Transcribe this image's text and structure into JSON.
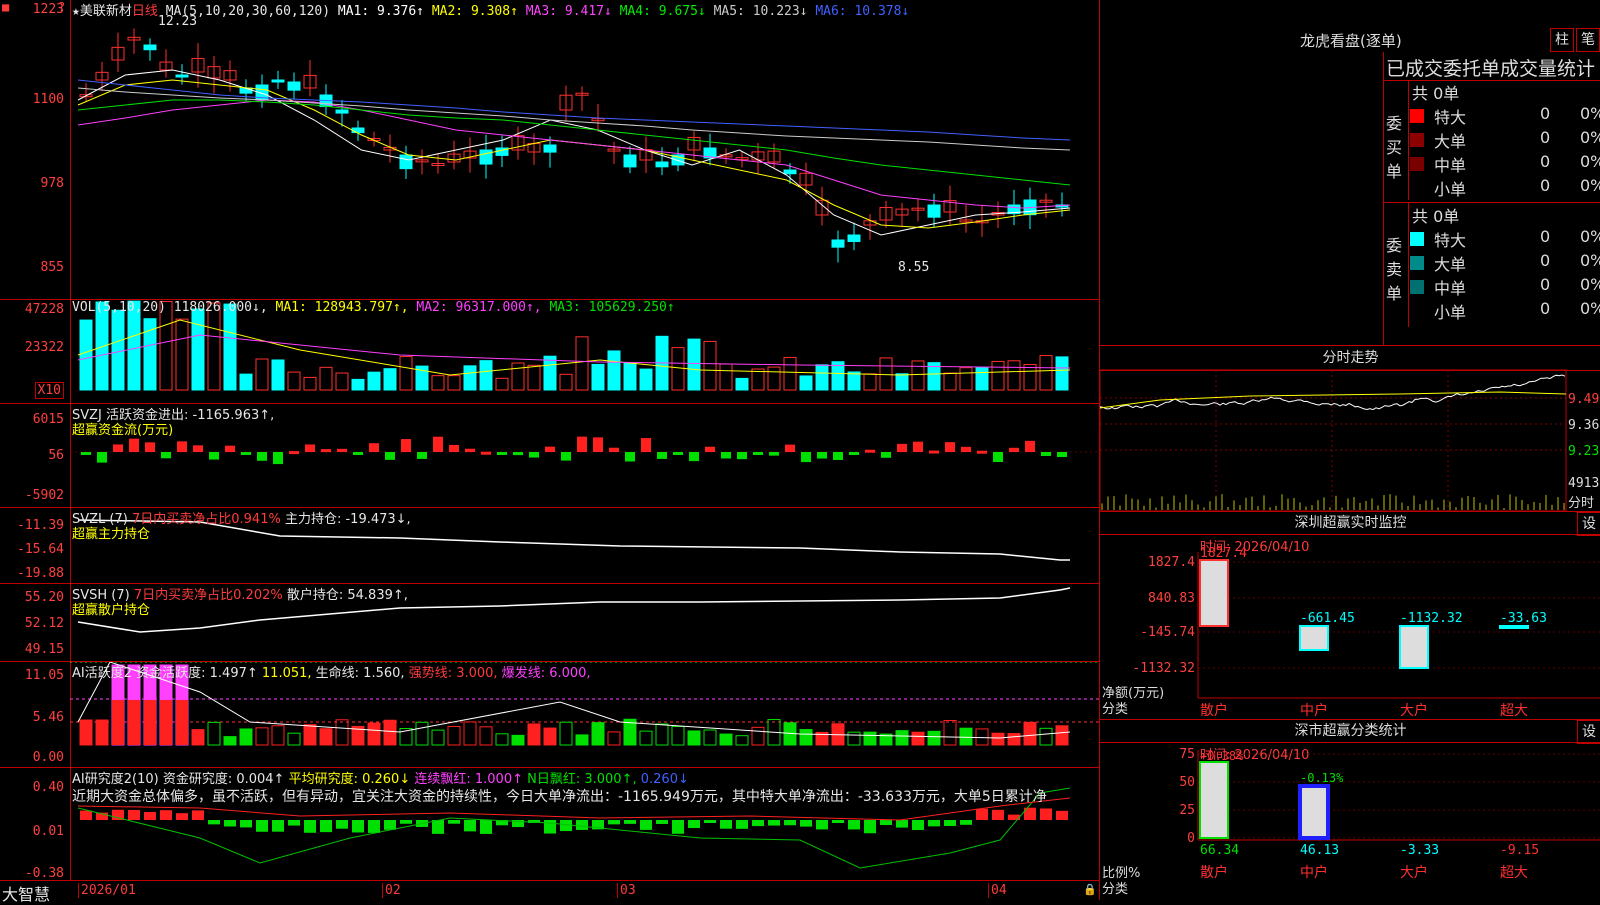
{
  "stock": {
    "star": "★",
    "name": "美联新材",
    "period": "日线"
  },
  "kline": {
    "ma_header": "MA(5,10,20,30,60,120)",
    "ma": [
      {
        "label": "MA1: 9.376↑",
        "color": "#ffffff"
      },
      {
        "label": "MA2: 9.308↑",
        "color": "#ffff00"
      },
      {
        "label": "MA3: 9.417↓",
        "color": "#ff40ff"
      },
      {
        "label": "MA4: 9.675↓",
        "color": "#00e000"
      },
      {
        "label": "MA5: 10.223↓",
        "color": "#cccccc"
      },
      {
        "label": "MA6: 10.378↓",
        "color": "#4060ff"
      }
    ],
    "y_ticks": [
      "12.23",
      "1100",
      "978",
      "855"
    ],
    "high_label": "12.23",
    "low_label": "8.55",
    "top_axis": "1223"
  },
  "vol": {
    "header": "VOL(5,10,20) 118026.000↓,",
    "ma1": "MA1: 128943.797↑,",
    "ma2": "MA2: 96317.000↑,",
    "ma3": "MA3: 105629.250↑",
    "y_ticks": [
      "47228",
      "23322"
    ],
    "unit": "X10"
  },
  "svzj": {
    "header": "SVZJ  活跃资金进出: -1165.963↑,",
    "sub": "超赢资金流(万元)",
    "y_ticks": [
      "6015",
      "56",
      "-5902"
    ]
  },
  "svzl": {
    "header": "SVZL (7)",
    "sub_a": "7日内买卖净占比0.941%",
    "sub_b": "主力持仓: -19.473↓,",
    "name": "超赢主力持仓",
    "y_ticks": [
      "-11.39",
      "-15.64",
      "-19.88"
    ]
  },
  "svsh": {
    "header": "SVSH (7)",
    "sub_a": "7日内买卖净占比0.202%",
    "sub_b": "散户持仓: 54.839↑,",
    "name": "超赢散户持仓",
    "y_ticks": [
      "55.20",
      "52.12",
      "49.15"
    ]
  },
  "ai1": {
    "header": "AI活跃度2",
    "a": "资金活跃度: 1.497↑",
    "b": "11.051,",
    "c": "生命线: 1.560,",
    "d": "强势线: 3.000,",
    "e": "爆发线: 6.000,",
    "y_ticks": [
      "11.05",
      "5.46",
      "0.00"
    ]
  },
  "ai2": {
    "header": "AI研究度2(10)",
    "a": "资金研究度: 0.004↑",
    "b": "平均研究度: 0.260↓",
    "c": "连续飘红: 1.000↑",
    "d": "N日飘红: 3.000↑,",
    "e": "0.260↓",
    "y_ticks": [
      "0.40",
      "0.01",
      "-0.38"
    ],
    "comment": "近期大资金总体偏多，虽不活跃，但有异动，宜关注大资金的持续性，今日大单净流出：-1165.949万元，其中特大单净流出：-33.633万元，大单5日累计净"
  },
  "xaxis": {
    "brand": "大智慧",
    "labels": [
      "2026/01",
      "02",
      "03",
      "04"
    ]
  },
  "lhb": {
    "title": "龙虎看盘(逐单)",
    "btn1": "柱",
    "btn2": "笔",
    "header": "已成交委托单成交量统计",
    "buy": {
      "side": "委买单",
      "total": "共 0单",
      "rows": [
        {
          "label": "特大",
          "count": "0",
          "pct": "0%",
          "color": "#ff0000"
        },
        {
          "label": "大单",
          "count": "0",
          "pct": "0%",
          "color": "#8b0000"
        },
        {
          "label": "中单",
          "count": "0",
          "pct": "0%",
          "color": "#7a0000"
        },
        {
          "label": "小单",
          "count": "0",
          "pct": "0%",
          "color": "#000000"
        }
      ]
    },
    "sell": {
      "side": "委卖单",
      "total": "共 0单",
      "rows": [
        {
          "label": "特大",
          "count": "0",
          "pct": "0%",
          "color": "#00ffff"
        },
        {
          "label": "大单",
          "count": "0",
          "pct": "0%",
          "color": "#008b8b"
        },
        {
          "label": "中单",
          "count": "0",
          "pct": "0%",
          "color": "#007070"
        },
        {
          "label": "小单",
          "count": "0",
          "pct": "0%",
          "color": "#000000"
        }
      ]
    }
  },
  "fenshi": {
    "title": "分时走势",
    "y_ticks": [
      "9.49",
      "9.36",
      "9.23"
    ],
    "vol_label": "4913",
    "vol_unit": "分时"
  },
  "szss": {
    "title": "深圳超赢实时监控",
    "btn": "设",
    "time": "时间: 2026/04/10",
    "y_ticks": [
      "1827.4",
      "840.83",
      "-145.74",
      "-1132.32"
    ],
    "ylab": "净额(万元)",
    "xlab": "分类",
    "cats": [
      "散户",
      "中户",
      "大户",
      "超大"
    ],
    "values": [
      "1827.4",
      "-661.45",
      "-1132.32",
      "-33.63"
    ]
  },
  "szfl": {
    "title": "深市超赢分类统计",
    "btn": "设",
    "time": "时间: 2026/04/10",
    "y_ticks": [
      "75",
      "50",
      "25",
      "0"
    ],
    "ylab": "比例%",
    "xlab": "分类",
    "cats": [
      "散户",
      "中户",
      "大户",
      "超大"
    ],
    "top": [
      "+0.38%",
      "-0.13%"
    ],
    "bottom": [
      "66.34",
      "46.13",
      "-3.33",
      "-9.15"
    ]
  }
}
